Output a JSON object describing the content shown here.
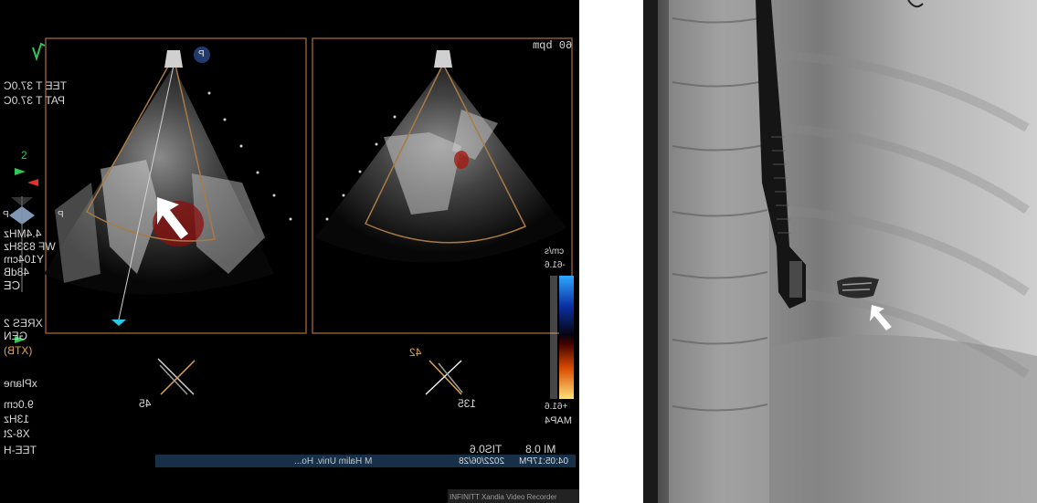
{
  "echo": {
    "heart_rate": "60 bpm",
    "tee_temp": "TEE T 37.0C",
    "pat_temp": "PAT T 37.0C",
    "freq_lines": [
      "4.4MHz",
      "WF 833Hz",
      "Y104cm",
      "48dB"
    ],
    "ce": "CE",
    "xres": "XRES 2",
    "gen": "GEN",
    "lines_lower": [
      "(XTB)",
      "xPlane",
      "9.0cm",
      "13Hz",
      "X8-2t",
      "TEE-H"
    ],
    "angle_left": "45",
    "angle_right": "135",
    "angle_right_top": "42",
    "tis": "TIS0.6",
    "mi": "MI 0.8",
    "date": "2022/06/28",
    "time": "04:05:17PM",
    "patient": "M  Halim Univ. Ho...",
    "scale_top": "cm/s",
    "scale_top_val": "-61.6",
    "scale_bottom_val": "+61.6",
    "scale_map": "MAP4",
    "recorder": "INFINITT Xandia Video Recorder",
    "marker_letter": "P",
    "side_letter_left": "P",
    "side_letter_right": "P",
    "scale_number": "2",
    "colors": {
      "frame": "#8a5a2e",
      "accent": "#e2a24b",
      "cyan": "#29c8e8",
      "green": "#33c45a",
      "red": "#e0332b"
    }
  },
  "xray": {
    "description_icons": [
      "tee-probe",
      "occluder-device-arrow"
    ]
  }
}
